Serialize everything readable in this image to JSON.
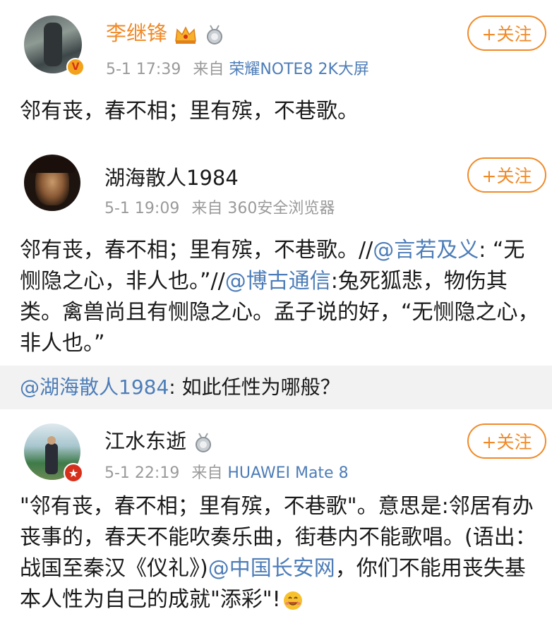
{
  "colors": {
    "accent": "#f08a28",
    "link": "#4d7db8",
    "meta": "#9a9a9a",
    "quote_bg": "#f2f2f2"
  },
  "posts": [
    {
      "name": "李继锋",
      "time": "5-1 17:39",
      "from": "来自",
      "source": "荣耀NOTE8 2K大屏",
      "follow": "+关注",
      "text": "邻有丧，春不相；里有殡，不巷歌。",
      "avatar_badge": "V"
    },
    {
      "name": "湖海散人1984",
      "time": "5-1 19:09",
      "from": "来自",
      "source": "360安全浏览器",
      "follow": "+关注",
      "text_parts": [
        "邻有丧，春不相；里有殡，不巷歌。//",
        "@言若及义",
        ":\n“无恻隐之心，非人也。”//",
        "@博古通信",
        ":兔死狐悲，物伤其类。禽兽尚且有恻隐之心。孟子说的好，“无恻隐之心，非人也。”"
      ]
    },
    {
      "quote_mention": "@湖海散人1984",
      "quote_text": ": 如此任性为哪般？"
    },
    {
      "name": "江水东逝",
      "time": "5-1 22:19",
      "from": "来自",
      "source": "HUAWEI Mate 8",
      "follow": "+关注",
      "text_parts": [
        "\"邻有丧，春不相；里有殡，不巷歌\"。意思是:邻居有办丧事的，春天不能吹奏乐曲，街巷内不能歌唱。(语出：战国至秦汉《仪礼》)",
        "@中国长安网",
        "，你们不能用丧失基本人性为自己的成就\"添彩\"!"
      ],
      "emoji": "smile-emoji"
    }
  ]
}
